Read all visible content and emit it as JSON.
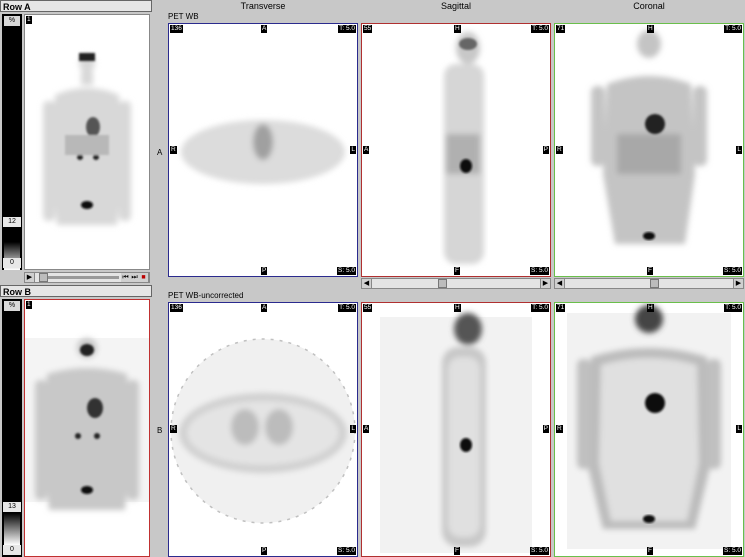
{
  "rowA": {
    "label": "Row A",
    "pct": "%",
    "maxval": "12",
    "minval": "0",
    "frame": "1"
  },
  "rowB": {
    "label": "Row B",
    "pct": "%",
    "maxval": "13",
    "minval": "0",
    "frame": "1"
  },
  "columns": [
    "Transverse",
    "Sagittal",
    "Coronal"
  ],
  "seriesA": "PET WB",
  "seriesB": "PET WB-uncorrected",
  "rowLetters": {
    "a": "A",
    "b": "B"
  },
  "slices": {
    "transverse": "136",
    "sagittal": "55",
    "coronal": "71"
  },
  "thickness": "T: 5.0",
  "spacing": "S: 5.0",
  "orient": {
    "A": "A",
    "P": "P",
    "R": "R",
    "L": "L",
    "H": "H",
    "F": "F"
  },
  "playback": {
    "prev": "⏮",
    "next": "⏭",
    "stop": "■"
  },
  "colors": {
    "transverse": "#2b2b8e",
    "sagittal": "#b03030",
    "coronal": "#6abf4b",
    "rowB_border": "#c03030"
  }
}
